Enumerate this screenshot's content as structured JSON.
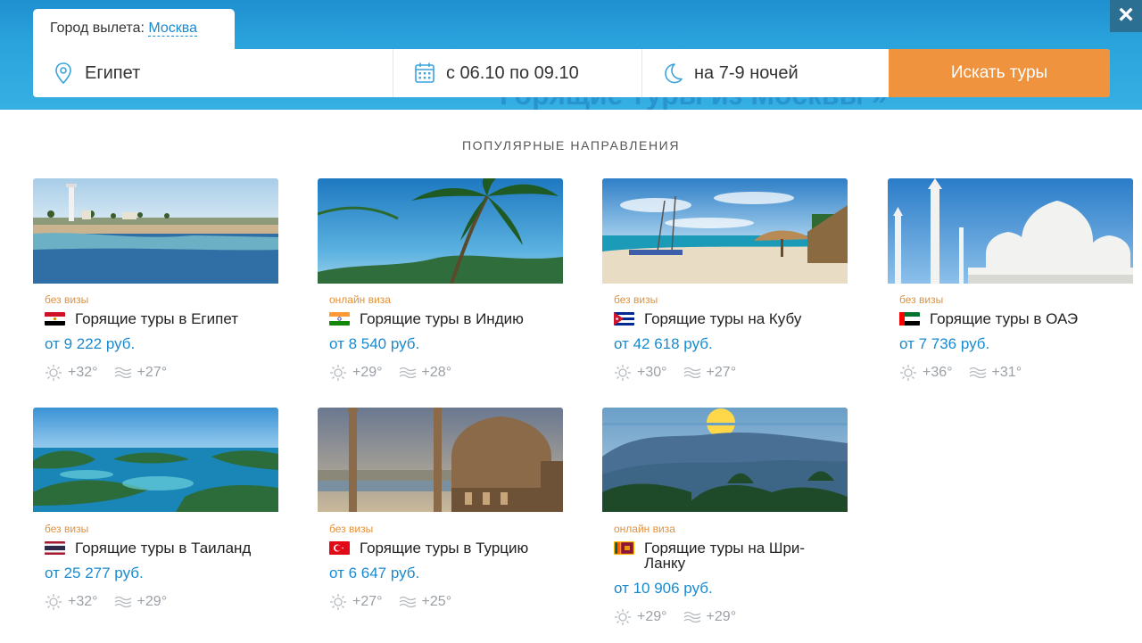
{
  "search": {
    "city_label": "Город вылета:",
    "city_value": "Москва",
    "destination": "Египет",
    "dates": "с 06.10 по 09.10",
    "nights": "на 7-9 ночей",
    "button": "Искать туры",
    "close": "×",
    "background_heading": "Горящие туры из Москвы »"
  },
  "section_title": "ПОПУЛЯРНЫЕ НАПРАВЛЕНИЯ",
  "colors": {
    "accent": "#1a8ad0",
    "button": "#f0933e",
    "visa": "#e3913a"
  },
  "cards": [
    {
      "visa": "без визы",
      "title": "Горящие туры в Египет",
      "price": "от  9 222 руб.",
      "air": "+32°",
      "water": "+27°",
      "flag": "egypt"
    },
    {
      "visa": "онлайн виза",
      "title": "Горящие туры в Индию",
      "price": "от  8 540 руб.",
      "air": "+29°",
      "water": "+28°",
      "flag": "india"
    },
    {
      "visa": "без визы",
      "title": "Горящие туры на Кубу",
      "price": "от  42 618 руб.",
      "air": "+30°",
      "water": "+27°",
      "flag": "cuba"
    },
    {
      "visa": "без визы",
      "title": "Горящие туры в ОАЭ",
      "price": "от 7 736 руб.",
      "air": "+36°",
      "water": "+31°",
      "flag": "uae"
    },
    {
      "visa": "без визы",
      "title": "Горящие туры в Таиланд",
      "price": "от 25 277 руб.",
      "air": "+32°",
      "water": "+29°",
      "flag": "thailand"
    },
    {
      "visa": "без визы",
      "title": "Горящие туры в Турцию",
      "price": "от 6  647 руб.",
      "air": "+27°",
      "water": "+25°",
      "flag": "turkey"
    },
    {
      "visa": "онлайн виза",
      "title": "Горящие туры на Шри-Ланку",
      "price": "от 10  906 руб.",
      "air": "+29°",
      "water": "+29°",
      "flag": "srilanka"
    }
  ]
}
